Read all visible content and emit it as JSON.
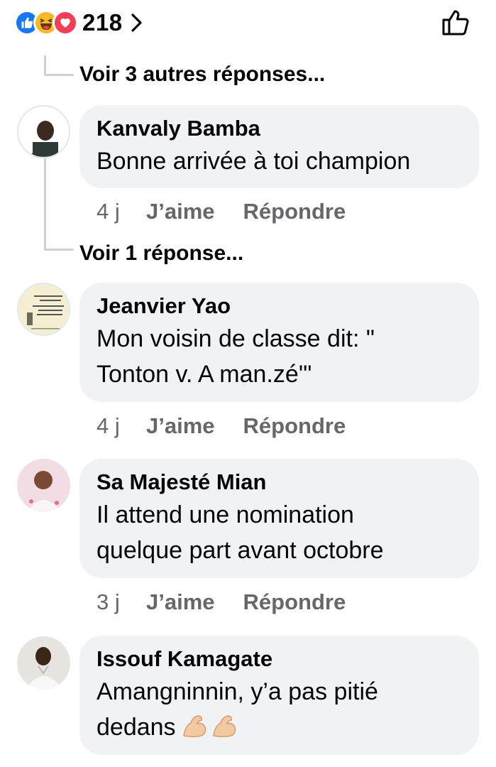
{
  "header": {
    "reaction_icons": [
      "like-icon",
      "haha-icon",
      "love-icon"
    ],
    "reaction_count": "218",
    "accent_like": "#1877f2",
    "accent_haha": "#f7b928",
    "accent_love": "#f33e58"
  },
  "threads": {
    "more_replies_1": "Voir 3 autres réponses...",
    "more_replies_2": "Voir 1 réponse..."
  },
  "comments": [
    {
      "author": "Kanvaly Bamba",
      "text_lines": [
        "Bonne arrivée à toi champion"
      ],
      "time": "4 j",
      "like": "J’aime",
      "reply": "Répondre"
    },
    {
      "author": "Jeanvier Yao",
      "text_lines": [
        "Mon voisin de classe dit: \"",
        "Tonton v. A  man.zé'\""
      ],
      "time": "4 j",
      "like": "J’aime",
      "reply": "Répondre"
    },
    {
      "author": "Sa Majesté Mian",
      "text_lines": [
        "Il attend une nomination",
        "quelque part avant octobre"
      ],
      "time": "3 j",
      "like": "J’aime",
      "reply": "Répondre"
    },
    {
      "author": "Issouf Kamagate",
      "text_lines": [
        "Amangninnin, y’a pas pitié",
        "dedans"
      ],
      "emoji": "flexed-biceps-icon"
    }
  ],
  "colors": {
    "bubble": "#f0f2f5",
    "secondary_text": "#65676b",
    "thread_line": "#ced0d4"
  }
}
